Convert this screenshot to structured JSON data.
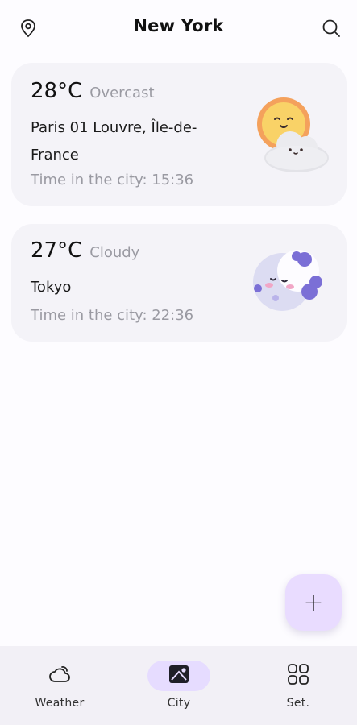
{
  "header": {
    "title": "New York",
    "location_icon": "location-pin-icon",
    "search_icon": "search-icon"
  },
  "cities": [
    {
      "temp": "28°C",
      "condition": "Overcast",
      "place": "Paris 01 Louvre, Île-de-France",
      "time": "Time in the city: 15:36",
      "icon": "sun-behind-cloud-icon"
    },
    {
      "temp": "27°C",
      "condition": "Cloudy",
      "place": "Tokyo",
      "time": "Time in the city: 22:36",
      "icon": "crescent-moon-icon"
    }
  ],
  "fab": {
    "label": "+",
    "icon": "plus-icon"
  },
  "nav": {
    "items": [
      {
        "label": "Weather",
        "icon": "weather-cloud-icon",
        "active": false
      },
      {
        "label": "City",
        "icon": "city-image-icon",
        "active": true
      },
      {
        "label": "Set.",
        "icon": "settings-grid-icon",
        "active": false
      }
    ]
  },
  "colors": {
    "background": "#fdfcff",
    "card": "#f4f3f8",
    "accent": "#e6dcff",
    "muted_text": "#9a9aa2",
    "nav_background": "#f2f0f6"
  }
}
